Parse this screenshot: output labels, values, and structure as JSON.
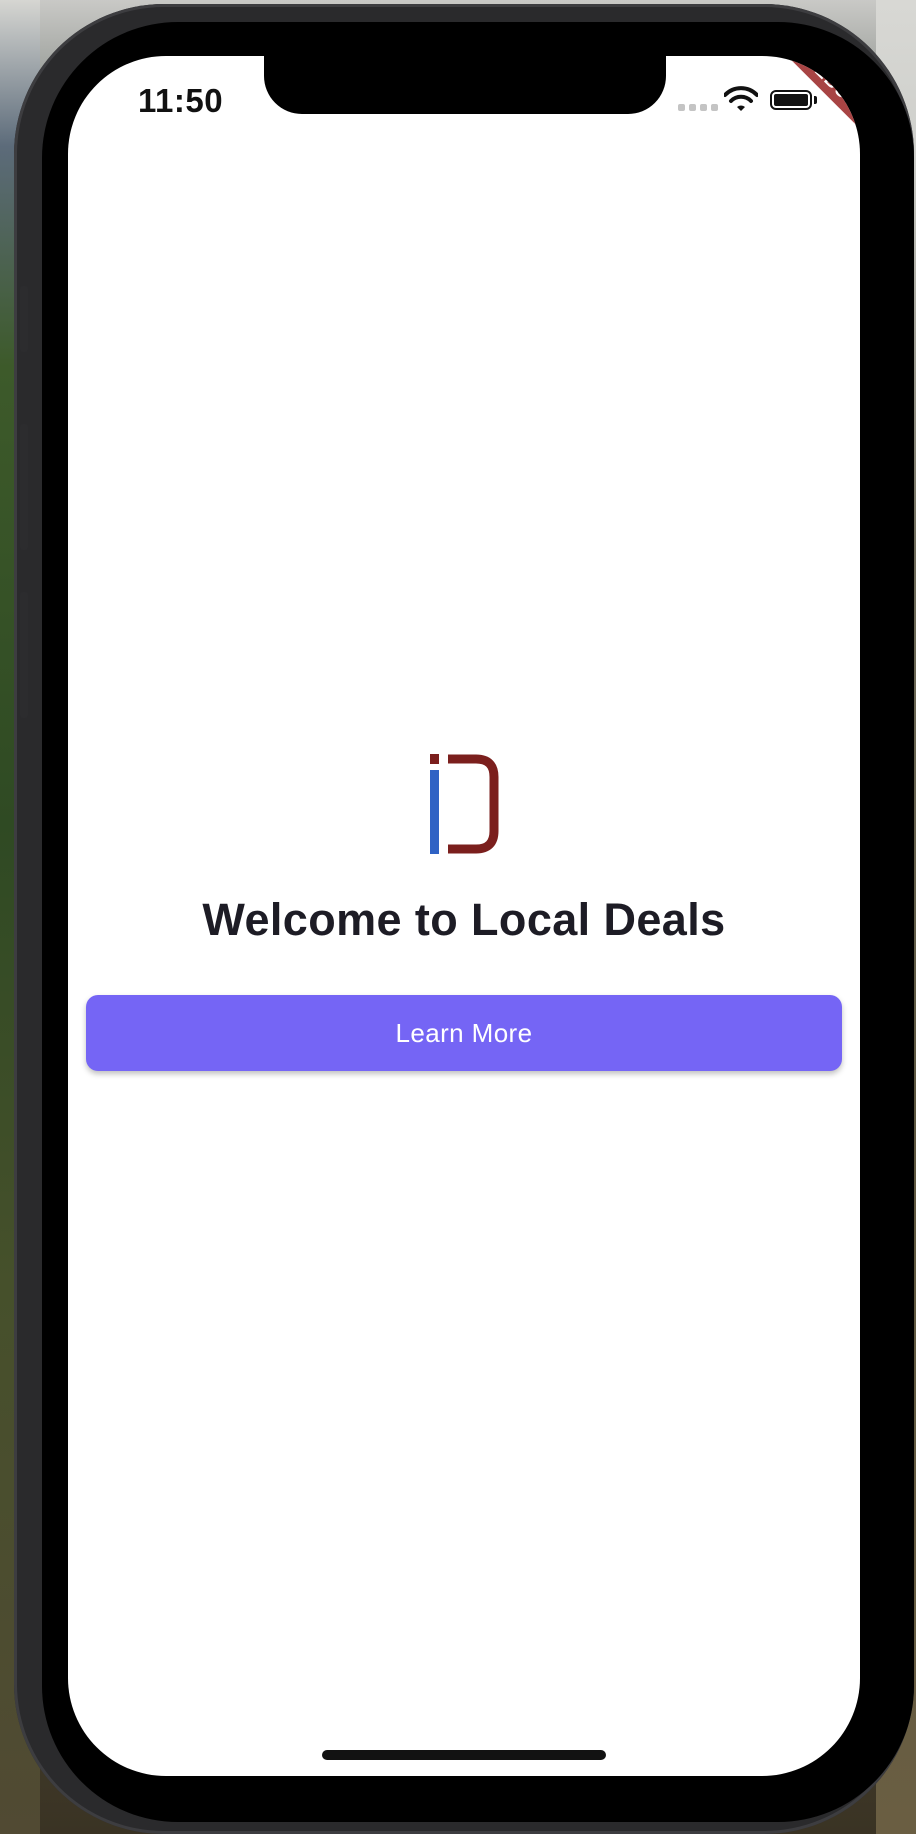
{
  "status_bar": {
    "time": "11:50",
    "wifi_icon": "wifi-icon",
    "battery_icon": "battery-icon"
  },
  "debug_banner": {
    "label": "DEBUG"
  },
  "main": {
    "logo_icon": "local-deals-logo",
    "title": "Welcome to Local Deals",
    "learn_more_label": "Learn More"
  },
  "colors": {
    "accent": "#7565f5",
    "title": "#1d1c25",
    "logo_blue": "#2f62c4",
    "logo_red": "#7b1f1d",
    "debug_banner": "#a84444"
  }
}
